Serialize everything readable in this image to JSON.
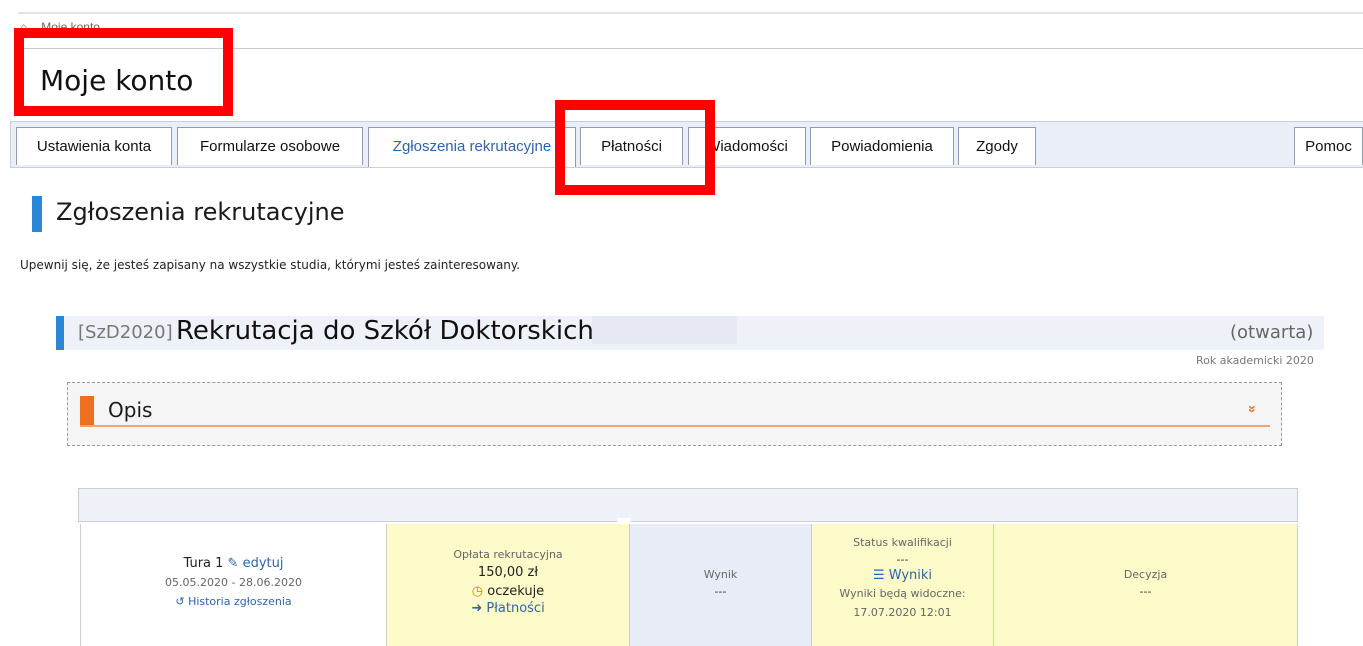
{
  "breadcrumb": {
    "home_icon": "home-icon",
    "current": "Moje konto"
  },
  "page_title": "Moje konto",
  "tabs": [
    {
      "label": "Ustawienia konta"
    },
    {
      "label": "Formularze osobowe"
    },
    {
      "label": "Zgłoszenia rekrutacyjne"
    },
    {
      "label": "Płatności"
    },
    {
      "label": "Wiadomości"
    },
    {
      "label": "Powiadomienia"
    },
    {
      "label": "Zgody"
    },
    {
      "label": "Pomoc"
    }
  ],
  "section": {
    "title": "Zgłoszenia rekrutacyjne",
    "hint": "Upewnij się, że jesteś zapisany na wszystkie studia, którymi jesteś zainteresowany."
  },
  "recruitment": {
    "code": "[SzD2020]",
    "name": "Rekrutacja do Szkół Doktorskich",
    "status": "(otwarta)",
    "academic_year": "Rok akademicki 2020",
    "opis_label": "Opis",
    "opis_chevron": "»"
  },
  "row": {
    "tura": {
      "label": "Tura 1",
      "edit_label": "edytuj",
      "dates": "05.05.2020 - 28.06.2020",
      "history_label": "Historia zgłoszenia"
    },
    "fee": {
      "label": "Opłata rekrutacyjna",
      "amount": "150,00 zł",
      "state": "oczekuje",
      "payments_link": "Płatności"
    },
    "result": {
      "label": "Wynik",
      "value": "---"
    },
    "qualification": {
      "label": "Status kwalifikacji",
      "value": "---",
      "results_link": "Wyniki",
      "visible_note": "Wyniki będą widoczne:",
      "visible_date": "17.07.2020 12:01"
    },
    "decision": {
      "label": "Decyzja",
      "value": "---"
    }
  },
  "colors": {
    "accent_blue": "#2a86d6",
    "accent_orange": "#ee6f1e",
    "annotation_red": "#ff0000",
    "cell_yellow": "#fbfac8"
  }
}
